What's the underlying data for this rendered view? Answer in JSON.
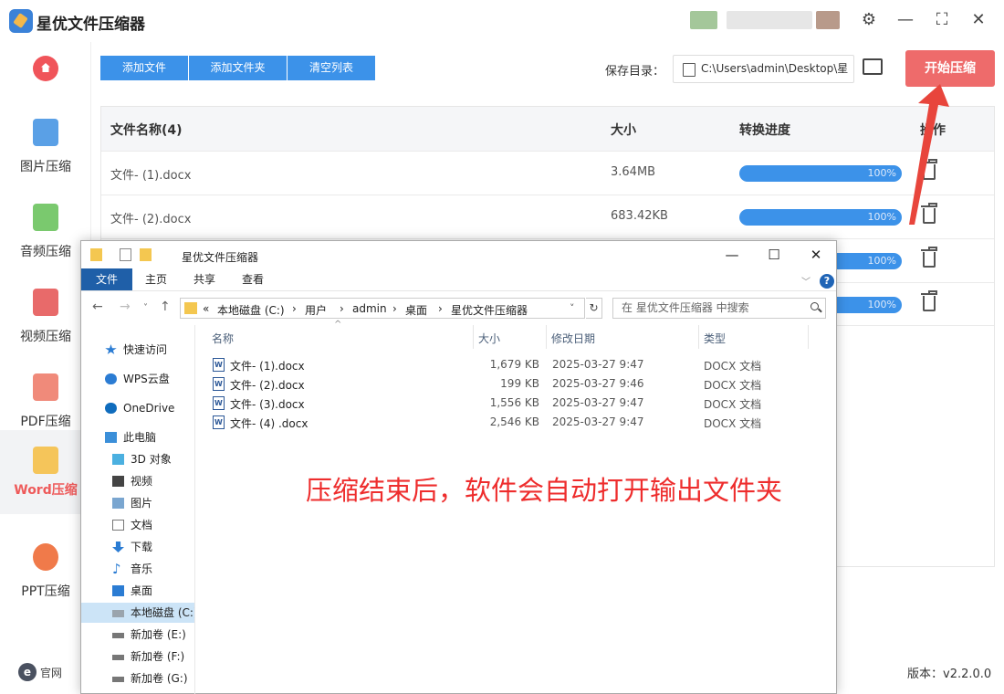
{
  "app": {
    "title": "星优文件压缩器",
    "version": "版本：v2.2.0.0",
    "site": "官网",
    "site_icon": "e"
  },
  "window_controls": {
    "settings": "⚙",
    "minimize": "—",
    "maximize": "⛶",
    "close": "✕"
  },
  "sidebar": {
    "items": [
      {
        "label": "图片压缩",
        "icon": "image-icon",
        "active": false
      },
      {
        "label": "音频压缩",
        "icon": "audio-icon",
        "active": false
      },
      {
        "label": "视频压缩",
        "icon": "video-icon",
        "active": false
      },
      {
        "label": "PDF压缩",
        "icon": "pdf-icon",
        "active": false
      },
      {
        "label": "Word压缩",
        "icon": "word-icon",
        "active": true
      },
      {
        "label": "PPT压缩",
        "icon": "ppt-icon",
        "active": false
      }
    ]
  },
  "toolbar": {
    "add_file": "添加文件",
    "add_folder": "添加文件夹",
    "clear_list": "清空列表",
    "save_label": "保存目录：",
    "save_path": "C:\\Users\\admin\\Desktop\\星",
    "start": "开始压缩"
  },
  "table": {
    "headers": {
      "name": "文件名称(4)",
      "size": "大小",
      "progress": "转换进度",
      "action": "操作"
    },
    "rows": [
      {
        "name": "文件- (1).docx",
        "size": "3.64MB",
        "progress": "100%"
      },
      {
        "name": "文件- (2).docx",
        "size": "683.42KB",
        "progress": "100%"
      },
      {
        "name": "",
        "size": "",
        "progress": "100%"
      },
      {
        "name": "",
        "size": "",
        "progress": "100%"
      }
    ]
  },
  "explorer": {
    "title": "星优文件压缩器",
    "ribbon_tabs": [
      "文件",
      "主页",
      "共享",
      "查看"
    ],
    "breadcrumb": [
      "«",
      "本地磁盘 (C:)",
      "›",
      "用户",
      "›",
      "admin",
      "›",
      "桌面",
      "›",
      "星优文件压缩器"
    ],
    "search_placeholder": "在 星优文件压缩器 中搜索",
    "nav": [
      "快速访问",
      "WPS云盘",
      "OneDrive",
      "此电脑",
      "3D 对象",
      "视频",
      "图片",
      "文档",
      "下载",
      "音乐",
      "桌面",
      "本地磁盘 (C:)",
      "新加卷 (E:)",
      "新加卷 (F:)",
      "新加卷 (G:)"
    ],
    "columns": {
      "name": "名称",
      "size": "大小",
      "date": "修改日期",
      "type": "类型"
    },
    "files": [
      {
        "name": "文件- (1).docx",
        "size": "1,679 KB",
        "date": "2025-03-27 9:47",
        "type": "DOCX 文档"
      },
      {
        "name": "文件- (2).docx",
        "size": "199 KB",
        "date": "2025-03-27 9:46",
        "type": "DOCX 文档"
      },
      {
        "name": "文件- (3).docx",
        "size": "1,556 KB",
        "date": "2025-03-27 9:47",
        "type": "DOCX 文档"
      },
      {
        "name": "文件- (4) .docx",
        "size": "2,546 KB",
        "date": "2025-03-27 9:47",
        "type": "DOCX 文档"
      }
    ]
  },
  "annotation": "压缩结束后，软件会自动打开输出文件夹",
  "colors": {
    "accent": "#3c92e9",
    "start_button": "#ee6b6b",
    "annotation": "#ee2d2d",
    "active_nav": "#ee5a5a"
  }
}
